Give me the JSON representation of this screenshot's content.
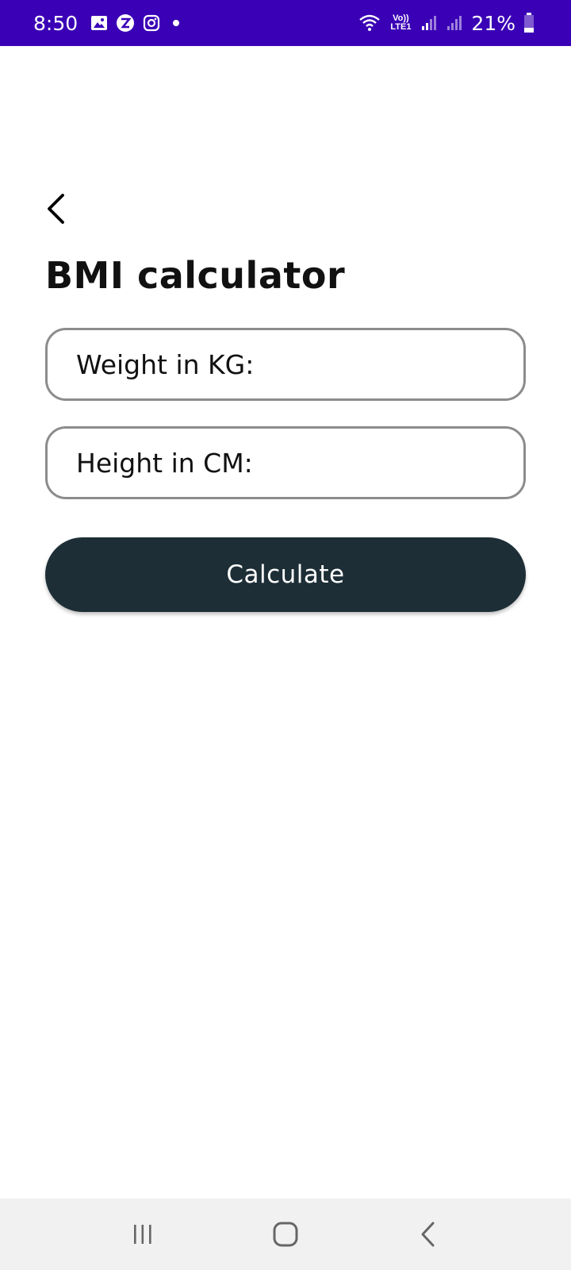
{
  "status_bar": {
    "time": "8:50",
    "battery_percent": "21%",
    "network_label": "Vo)) LTE1",
    "background_color": "#3a00b6",
    "icons": [
      "gallery-icon",
      "zoom-app-icon",
      "instagram-icon",
      "notification-dot-icon",
      "wifi-icon",
      "volte-icon",
      "signal-icon",
      "signal-icon",
      "battery-icon"
    ]
  },
  "header": {
    "back_icon": "chevron-left-icon",
    "title": "BMI calculator"
  },
  "form": {
    "weight_placeholder": "Weight in KG:",
    "weight_value": "",
    "height_placeholder": "Height in CM:",
    "height_value": "",
    "calculate_label": "Calculate",
    "button_color": "#1d2e36"
  },
  "nav_bar": {
    "icons": [
      "recent-apps-icon",
      "home-icon",
      "back-icon"
    ]
  }
}
